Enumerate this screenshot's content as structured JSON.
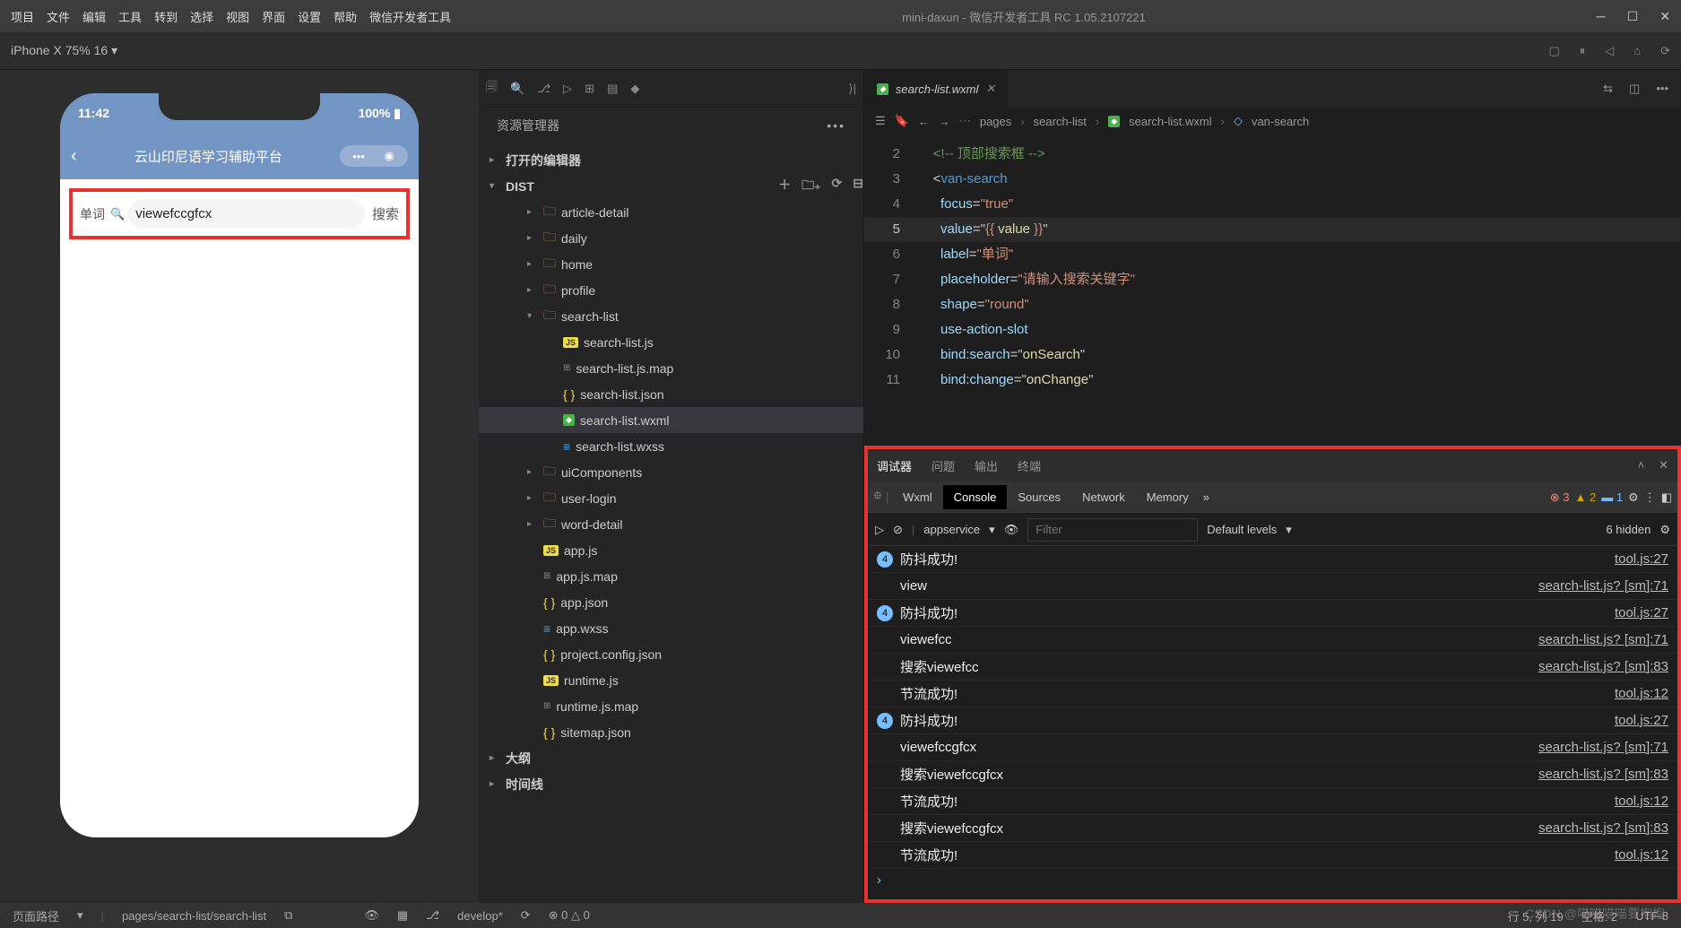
{
  "menu": [
    "项目",
    "文件",
    "编辑",
    "工具",
    "转到",
    "选择",
    "视图",
    "界面",
    "设置",
    "帮助",
    "微信开发者工具"
  ],
  "title": {
    "project": "mini-daxun",
    "app": "微信开发者工具 RC 1.05.2107221"
  },
  "device": "iPhone X 75% 16",
  "simulator": {
    "time": "11:42",
    "battery": "100%",
    "appTitle": "云山印尼语学习辅助平台",
    "searchLabel": "单词",
    "searchValue": "viewefccgfcx",
    "searchBtn": "搜索"
  },
  "explorer": {
    "header": "资源管理器",
    "sections": {
      "open": "打开的编辑器",
      "dist": "DIST",
      "outline": "大纲",
      "timeline": "时间线"
    },
    "tree": [
      {
        "d": 2,
        "t": "folder",
        "n": "article-detail"
      },
      {
        "d": 2,
        "t": "folder",
        "n": "daily"
      },
      {
        "d": 2,
        "t": "folder",
        "n": "home"
      },
      {
        "d": 2,
        "t": "folder",
        "n": "profile"
      },
      {
        "d": 2,
        "t": "folder",
        "n": "search-list",
        "open": true
      },
      {
        "d": 3,
        "t": "js",
        "n": "search-list.js"
      },
      {
        "d": 3,
        "t": "map",
        "n": "search-list.js.map"
      },
      {
        "d": 3,
        "t": "json",
        "n": "search-list.json"
      },
      {
        "d": 3,
        "t": "wxml",
        "n": "search-list.wxml",
        "active": true
      },
      {
        "d": 3,
        "t": "wxss",
        "n": "search-list.wxss"
      },
      {
        "d": 2,
        "t": "folder",
        "n": "uiComponents"
      },
      {
        "d": 2,
        "t": "folder",
        "n": "user-login"
      },
      {
        "d": 2,
        "t": "folder",
        "n": "word-detail"
      },
      {
        "d": 2,
        "t": "js",
        "n": "app.js"
      },
      {
        "d": 2,
        "t": "map",
        "n": "app.js.map"
      },
      {
        "d": 2,
        "t": "json",
        "n": "app.json"
      },
      {
        "d": 2,
        "t": "wxss",
        "n": "app.wxss"
      },
      {
        "d": 2,
        "t": "json",
        "n": "project.config.json"
      },
      {
        "d": 2,
        "t": "js",
        "n": "runtime.js"
      },
      {
        "d": 2,
        "t": "map",
        "n": "runtime.js.map"
      },
      {
        "d": 2,
        "t": "json",
        "n": "sitemap.json"
      }
    ]
  },
  "tabs": [
    {
      "name": "search-list.wxml",
      "icon": "wxml"
    }
  ],
  "breadcrumb": [
    "pages",
    "search-list",
    "search-list.wxml",
    "van-search"
  ],
  "code": [
    {
      "n": 2,
      "seg": [
        {
          "c": "comment",
          "t": "<!-- 顶部搜索框 -->"
        }
      ]
    },
    {
      "n": 3,
      "seg": [
        {
          "c": "punc",
          "t": "<"
        },
        {
          "c": "tag",
          "t": "van-search"
        }
      ]
    },
    {
      "n": 4,
      "seg": [
        {
          "c": "attr",
          "t": "  focus"
        },
        {
          "c": "punc",
          "t": "="
        },
        {
          "c": "str",
          "t": "\"true\""
        }
      ]
    },
    {
      "n": 5,
      "hl": true,
      "seg": [
        {
          "c": "attr",
          "t": "  value"
        },
        {
          "c": "punc",
          "t": "=\""
        },
        {
          "c": "str",
          "t": "{{ "
        },
        {
          "c": "val",
          "t": "value"
        },
        {
          "c": "str",
          "t": " }}"
        },
        {
          "c": "punc",
          "t": "\""
        }
      ]
    },
    {
      "n": 6,
      "seg": [
        {
          "c": "attr",
          "t": "  label"
        },
        {
          "c": "punc",
          "t": "="
        },
        {
          "c": "str",
          "t": "\"单词\""
        }
      ]
    },
    {
      "n": 7,
      "seg": [
        {
          "c": "attr",
          "t": "  placeholder"
        },
        {
          "c": "punc",
          "t": "="
        },
        {
          "c": "str",
          "t": "\"请输入搜索关键字\""
        }
      ]
    },
    {
      "n": 8,
      "seg": [
        {
          "c": "attr",
          "t": "  shape"
        },
        {
          "c": "punc",
          "t": "="
        },
        {
          "c": "str",
          "t": "\"round\""
        }
      ]
    },
    {
      "n": 9,
      "seg": [
        {
          "c": "attr",
          "t": "  use-action-slot"
        }
      ]
    },
    {
      "n": 10,
      "seg": [
        {
          "c": "attr",
          "t": "  bind:search"
        },
        {
          "c": "punc",
          "t": "=\""
        },
        {
          "c": "val",
          "t": "onSearch"
        },
        {
          "c": "punc",
          "t": "\""
        }
      ]
    },
    {
      "n": 11,
      "seg": [
        {
          "c": "attr",
          "t": "  bind:change"
        },
        {
          "c": "punc",
          "t": "=\""
        },
        {
          "c": "val",
          "t": "onChange"
        },
        {
          "c": "punc",
          "t": "\""
        }
      ]
    }
  ],
  "debugger": {
    "tabs": [
      "调试器",
      "问题",
      "输出",
      "终端"
    ],
    "devtabs": [
      "Wxml",
      "Console",
      "Sources",
      "Network",
      "Memory"
    ],
    "activeDevTab": "Console",
    "badges": {
      "err": 3,
      "warn": 2,
      "info": 1
    },
    "context": "appservice",
    "filterPlaceholder": "Filter",
    "levels": "Default levels",
    "hidden": "6 hidden",
    "logs": [
      {
        "count": 4,
        "msg": "防抖成功!",
        "src": "tool.js:27"
      },
      {
        "msg": "view",
        "src": "search-list.js? [sm]:71"
      },
      {
        "count": 4,
        "msg": "防抖成功!",
        "src": "tool.js:27"
      },
      {
        "msg": "viewefcc",
        "src": "search-list.js? [sm]:71"
      },
      {
        "msg": "搜索viewefcc",
        "src": "search-list.js? [sm]:83"
      },
      {
        "msg": "节流成功!",
        "src": "tool.js:12"
      },
      {
        "count": 4,
        "msg": "防抖成功!",
        "src": "tool.js:27"
      },
      {
        "msg": "viewefccgfcx",
        "src": "search-list.js? [sm]:71"
      },
      {
        "msg": "搜索viewefccgfcx",
        "src": "search-list.js? [sm]:83"
      },
      {
        "msg": "节流成功!",
        "src": "tool.js:12"
      },
      {
        "msg": "搜索viewefccgfcx",
        "src": "search-list.js? [sm]:83"
      },
      {
        "msg": "节流成功!",
        "src": "tool.js:12"
      }
    ]
  },
  "status": {
    "path": "页面路径",
    "pathValue": "pages/search-list/search-list",
    "branch": "develop*",
    "errs": "⊗ 0 △ 0",
    "cursor": "行 5, 列 19",
    "spaces": "空格: 2",
    "encoding": "UTF-8",
    "watermark": "CSDN @喵喵喵喵要抱抱"
  }
}
